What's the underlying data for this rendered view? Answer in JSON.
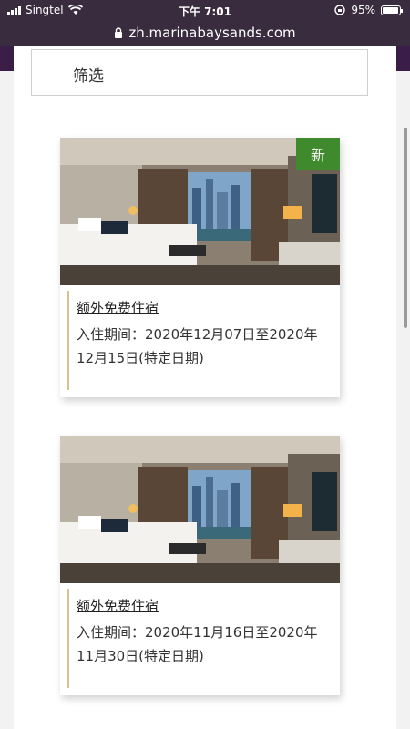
{
  "status": {
    "carrier": "Singtel",
    "time": "下午 7:01",
    "battery": "95%"
  },
  "browser": {
    "url": "zh.marinabaysands.com"
  },
  "filter": {
    "label": "筛选"
  },
  "offers": [
    {
      "badge": "新",
      "title": "额外免费住宿",
      "period": "入住期间：2020年12月07日至2020年12月15日(特定日期)"
    },
    {
      "badge": "",
      "title": "额外免费住宿",
      "period": "入住期间：2020年11月16日至2020年11月30日(特定日期)"
    }
  ]
}
